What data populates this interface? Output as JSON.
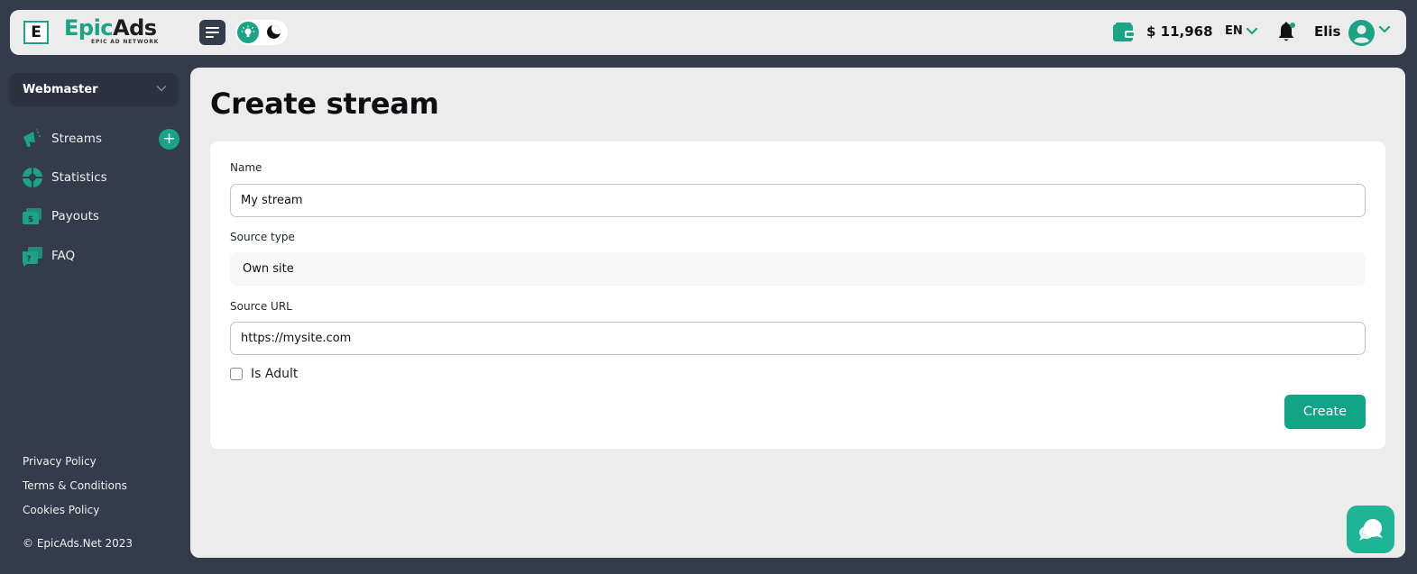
{
  "header": {
    "logo_mark": "E",
    "brand_part1": "Epic",
    "brand_part2": "Ads",
    "brand_tagline": "EPIC AD NETWORK",
    "balance": "$ 11,968",
    "language": "EN",
    "username": "Elis",
    "icons": [
      "menu-icon",
      "sun-icon",
      "moon-icon",
      "wallet-icon",
      "chevron-down-icon",
      "bell-icon",
      "avatar-icon"
    ]
  },
  "sidebar": {
    "role": "Webmaster",
    "items": [
      {
        "label": "Streams",
        "icon": "megaphone-icon"
      },
      {
        "label": "Statistics",
        "icon": "pie-chart-icon"
      },
      {
        "label": "Payouts",
        "icon": "money-icon"
      },
      {
        "label": "FAQ",
        "icon": "faq-chat-icon"
      }
    ],
    "add_stream": "+",
    "footer_links": [
      "Privacy Policy",
      "Terms & Conditions",
      "Cookies Policy"
    ],
    "copyright": "© EpicAds.Net 2023"
  },
  "main": {
    "title": "Create stream",
    "form": {
      "name_label": "Name",
      "name_value": "My stream",
      "source_type_label": "Source type",
      "source_type_value": "Own site",
      "source_url_label": "Source URL",
      "source_url_value": "https://mysite.com",
      "is_adult_label": "Is Adult",
      "is_adult_checked": false,
      "submit_label": "Create"
    }
  },
  "colors": {
    "accent": "#1aa385",
    "sidebar_bg": "#343b4b",
    "panel_bg": "#ececec"
  }
}
